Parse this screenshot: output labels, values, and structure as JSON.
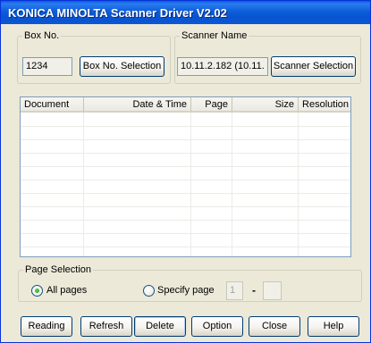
{
  "window": {
    "title": "KONICA MINOLTA Scanner Driver V2.02"
  },
  "box_no": {
    "group_label": "Box No.",
    "value": "1234",
    "button_label": "Box No. Selection"
  },
  "scanner": {
    "group_label": "Scanner Name",
    "value": "10.11.2.182 (10.11.",
    "button_label": "Scanner Selection"
  },
  "list": {
    "columns": [
      "Document",
      "Date & Time",
      "Page",
      "Size",
      "Resolution"
    ],
    "rows": []
  },
  "page_selection": {
    "group_label": "Page Selection",
    "options": [
      "All pages",
      "Specify page"
    ],
    "selected": "All pages",
    "from_page": "1",
    "separator": "-",
    "to_page": ""
  },
  "buttons": {
    "reading": "Reading",
    "refresh": "Refresh",
    "delete": "Delete",
    "option": "Option",
    "close": "Close",
    "help": "Help"
  },
  "colors": {
    "titlebar": "#0a5bd8",
    "dialog_bg": "#ece9d8",
    "button_border": "#003c74",
    "radio_dot": "#21a121"
  }
}
